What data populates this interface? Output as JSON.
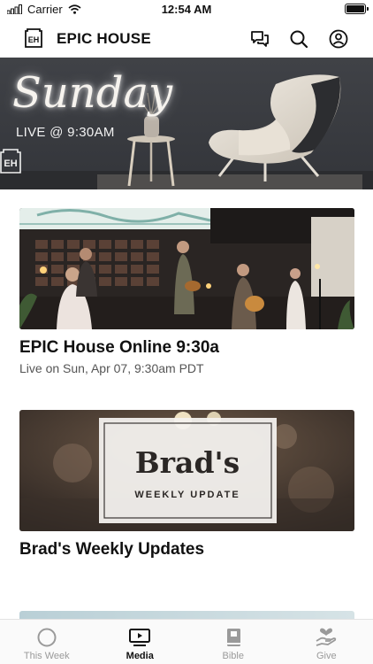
{
  "status_bar": {
    "carrier": "Carrier",
    "time": "12:54 AM"
  },
  "header": {
    "brand_name": "EPIC HOUSE",
    "logo_letters": "EH"
  },
  "hero": {
    "title": "Sunday",
    "subtitle": "LIVE @ 9:30AM",
    "logo_letters": "EH"
  },
  "media": [
    {
      "title": "EPIC House Online 9:30a",
      "subtitle": "Live on Sun, Apr 07, 9:30am PDT"
    },
    {
      "title": "Brad's Weekly Updates",
      "subtitle": "",
      "thumb_heading": "Brad's",
      "thumb_subheading": "WEEKLY UPDATE"
    }
  ],
  "tabs": [
    {
      "label": "This Week",
      "icon": "circle-icon",
      "active": false
    },
    {
      "label": "Media",
      "icon": "play-screen-icon",
      "active": true
    },
    {
      "label": "Bible",
      "icon": "book-icon",
      "active": false
    },
    {
      "label": "Give",
      "icon": "hand-heart-icon",
      "active": false
    }
  ]
}
